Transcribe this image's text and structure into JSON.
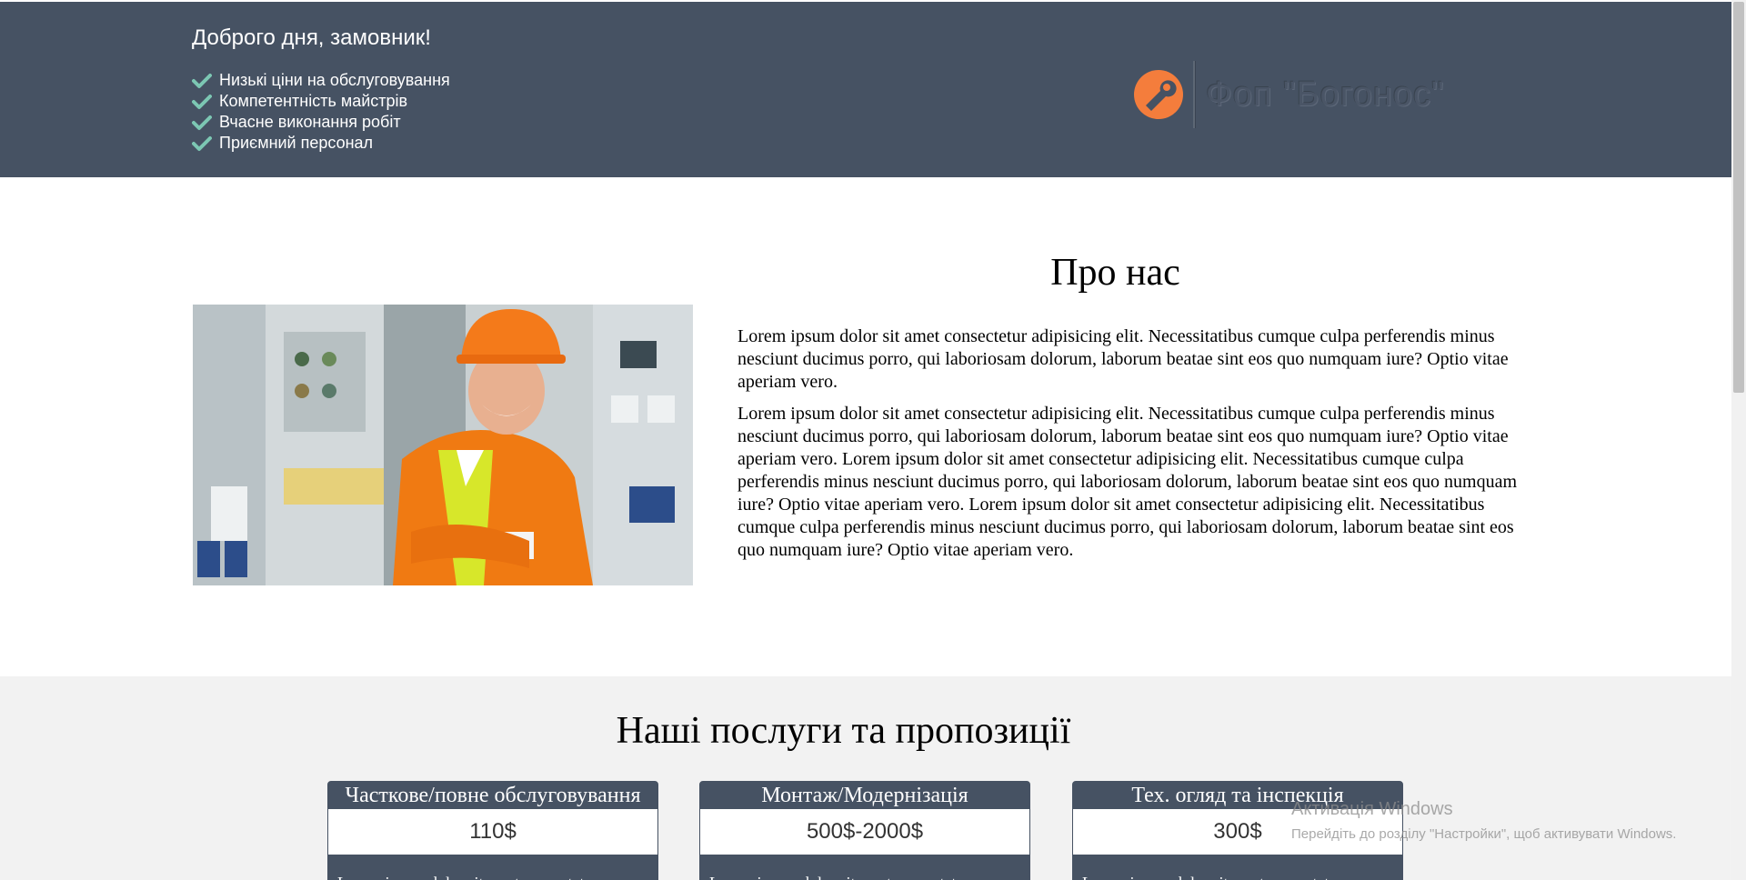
{
  "header": {
    "greeting": "Доброго дня, замовник!",
    "features": [
      "Низькі ціни на обслуговування",
      "Компетентність майстрів",
      "Вчасне виконання робіт",
      "Приємний персонал"
    ],
    "logo_text": "Фоп \"Богонос\"",
    "colors": {
      "background": "#465263",
      "accent": "#f47d3c",
      "check": "#7cc7b3"
    }
  },
  "about": {
    "title": "Про нас",
    "paragraphs": [
      "Lorem ipsum dolor sit amet consectetur adipisicing elit. Necessitatibus cumque culpa perferendis minus nesciunt ducimus porro, qui laboriosam dolorum, laborum beatae sint eos quo numquam iure? Optio vitae aperiam vero.",
      "Lorem ipsum dolor sit amet consectetur adipisicing elit. Necessitatibus cumque culpa perferendis minus nesciunt ducimus porro, qui laboriosam dolorum, laborum beatae sint eos quo numquam iure? Optio vitae aperiam vero. Lorem ipsum dolor sit amet consectetur adipisicing elit. Necessitatibus cumque culpa perferendis minus nesciunt ducimus porro, qui laboriosam dolorum, laborum beatae sint eos quo numquam iure? Optio vitae aperiam vero. Lorem ipsum dolor sit amet consectetur adipisicing elit. Necessitatibus cumque culpa perferendis minus nesciunt ducimus porro, qui laboriosam dolorum, laborum beatae sint eos quo numquam iure? Optio vitae aperiam vero."
    ]
  },
  "services": {
    "title": "Наші послуги та пропозиції",
    "cards": [
      {
        "title": "Часткове/повне обслуговування",
        "price": "110$",
        "text": "Lorem ipsum dolor sit amet consectetur"
      },
      {
        "title": "Монтаж/Модернізація",
        "price": "500$-2000$",
        "text": "Lorem ipsum dolor sit amet consectetur"
      },
      {
        "title": "Тех. огляд та інспекція",
        "price": "300$",
        "text": "Lorem ipsum dolor sit amet consectetur"
      }
    ]
  },
  "watermark": {
    "title": "Активація Windows",
    "subtitle": "Перейдіть до розділу \"Настройки\", щоб активувати Windows."
  }
}
